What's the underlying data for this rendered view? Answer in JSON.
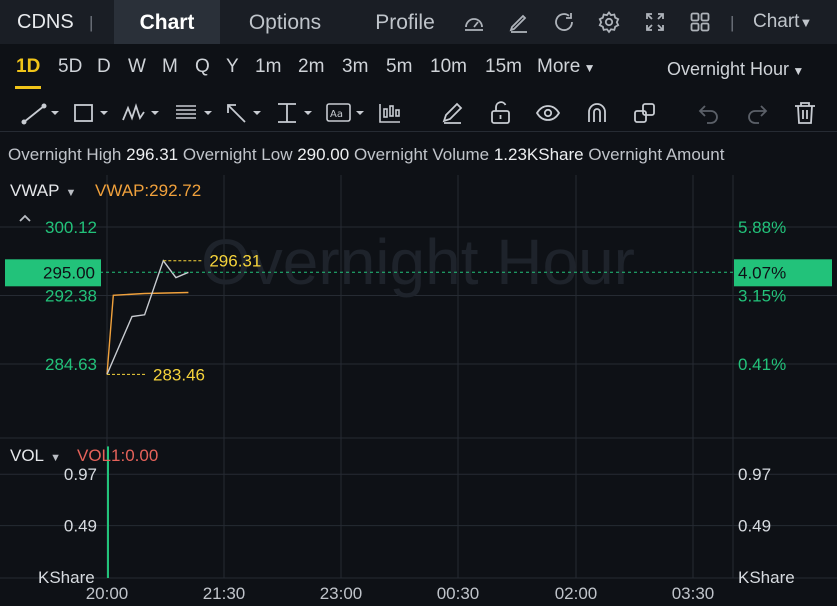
{
  "header": {
    "ticker": "CDNS",
    "separator": "|",
    "tabs": [
      "Chart",
      "Options",
      "Profile"
    ],
    "chart_menu": "Chart"
  },
  "icons": {
    "top": [
      "gauge-icon",
      "edit-icon",
      "refresh-icon",
      "settings-icon",
      "fullscreen-icon",
      "grid-icon"
    ],
    "tools": [
      "trendline-icon",
      "rectangle-icon",
      "pattern-icon",
      "fibonacci-icon",
      "arrow-icon",
      "measure-icon",
      "text-icon",
      "candle-icon",
      "pencil-icon",
      "unlock-icon",
      "eye-icon",
      "magnet-icon",
      "layers-icon",
      "undo-icon",
      "redo-icon",
      "trash-icon"
    ]
  },
  "periods": {
    "items": [
      "1D",
      "5D",
      "D",
      "W",
      "M",
      "Q",
      "Y",
      "1m",
      "2m",
      "3m",
      "5m",
      "10m",
      "15m"
    ],
    "more": "More",
    "active": "1D",
    "session": "Overnight Hour"
  },
  "stats": {
    "high_label": "Overnight High",
    "high_value": "296.31",
    "low_label": "Overnight Low",
    "low_value": "290.00",
    "volume_label": "Overnight Volume",
    "volume_value": "1.23KShare",
    "amount_label": "Overnight Amount"
  },
  "indicators": {
    "vwap_name": "VWAP",
    "vwap_value": "VWAP:292.72",
    "vol_name": "VOL",
    "vol_value": "VOL1:0.00"
  },
  "watermark": "Overnight Hour",
  "colors": {
    "background": "#0e1116",
    "up": "#22c27a",
    "current_badge": "#22c27a",
    "vwap": "#f0a13c",
    "marker": "#f5d33b",
    "active": "#f0c419",
    "vol_value": "#e5625a"
  },
  "chart_data": {
    "type": "line",
    "ylim": [
      280,
      306
    ],
    "price_ticks": [
      {
        "price": "300.12",
        "pct": "5.88%",
        "v": 300.12
      },
      {
        "price": "292.38",
        "pct": "3.15%",
        "v": 292.38
      },
      {
        "price": "284.63",
        "pct": "0.41%",
        "v": 284.63
      }
    ],
    "current": {
      "price": "295.00",
      "pct": "4.07%",
      "v": 295.0
    },
    "markers": [
      {
        "label": "296.31",
        "v": 296.31
      },
      {
        "label": "283.46",
        "v": 283.46
      }
    ],
    "x_labels": [
      "20:00",
      "21:30",
      "23:00",
      "00:30",
      "02:00",
      "03:30"
    ],
    "price_series": {
      "name": "",
      "points": [
        {
          "t": 0.0,
          "v": 283.46
        },
        {
          "t": 0.04,
          "v": 290.0
        },
        {
          "t": 0.06,
          "v": 290.2
        },
        {
          "t": 0.09,
          "v": 296.31
        },
        {
          "t": 0.11,
          "v": 294.4
        },
        {
          "t": 0.13,
          "v": 295.0
        }
      ]
    },
    "vwap_series": {
      "name": "VWAP",
      "points": [
        {
          "t": 0.0,
          "v": 283.46
        },
        {
          "t": 0.01,
          "v": 292.4
        },
        {
          "t": 0.06,
          "v": 292.6
        },
        {
          "t": 0.13,
          "v": 292.72
        }
      ]
    },
    "volume": {
      "ylim": [
        0,
        1.29
      ],
      "ticks": [
        {
          "label": "0.97",
          "v": 0.97
        },
        {
          "label": "0.49",
          "v": 0.49
        }
      ],
      "unit": "KShare",
      "bars": [
        {
          "t": 0.0,
          "v": 1.23
        }
      ]
    }
  }
}
